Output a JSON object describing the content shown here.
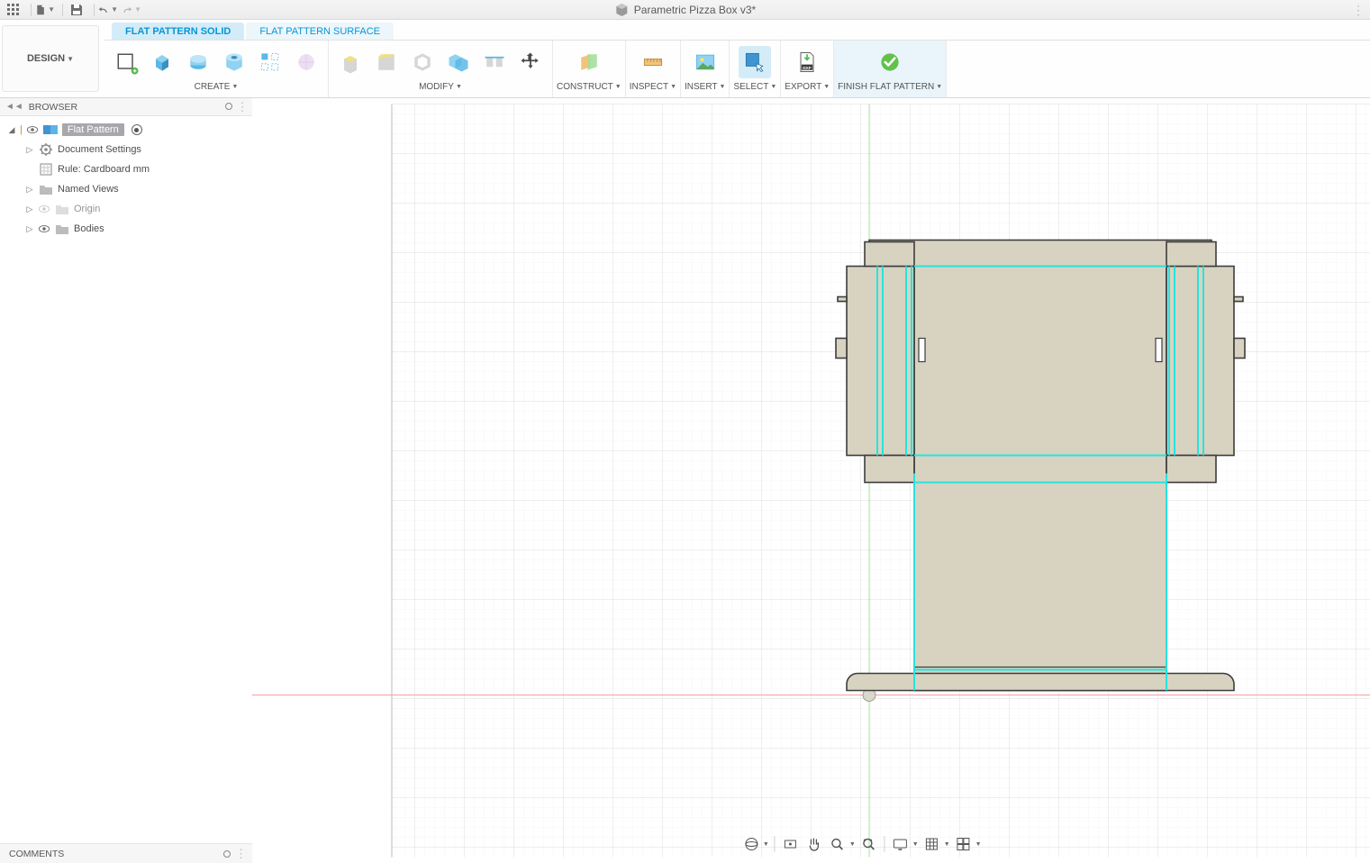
{
  "qab": {
    "title": "Parametric Pizza Box v3*"
  },
  "designBtn": "DESIGN",
  "tabs": {
    "solid": "FLAT PATTERN SOLID",
    "surface": "FLAT PATTERN SURFACE"
  },
  "groups": {
    "create": "CREATE",
    "modify": "MODIFY",
    "construct": "CONSTRUCT",
    "inspect": "INSPECT",
    "insert": "INSERT",
    "select": "SELECT",
    "export": "EXPORT",
    "finish": "FINISH FLAT PATTERN"
  },
  "browser": {
    "header": "BROWSER",
    "root": "Flat Pattern",
    "items": {
      "docSettings": "Document Settings",
      "rule": "Rule: Cardboard mm",
      "namedViews": "Named Views",
      "origin": "Origin",
      "bodies": "Bodies"
    }
  },
  "comments": "COMMENTS"
}
